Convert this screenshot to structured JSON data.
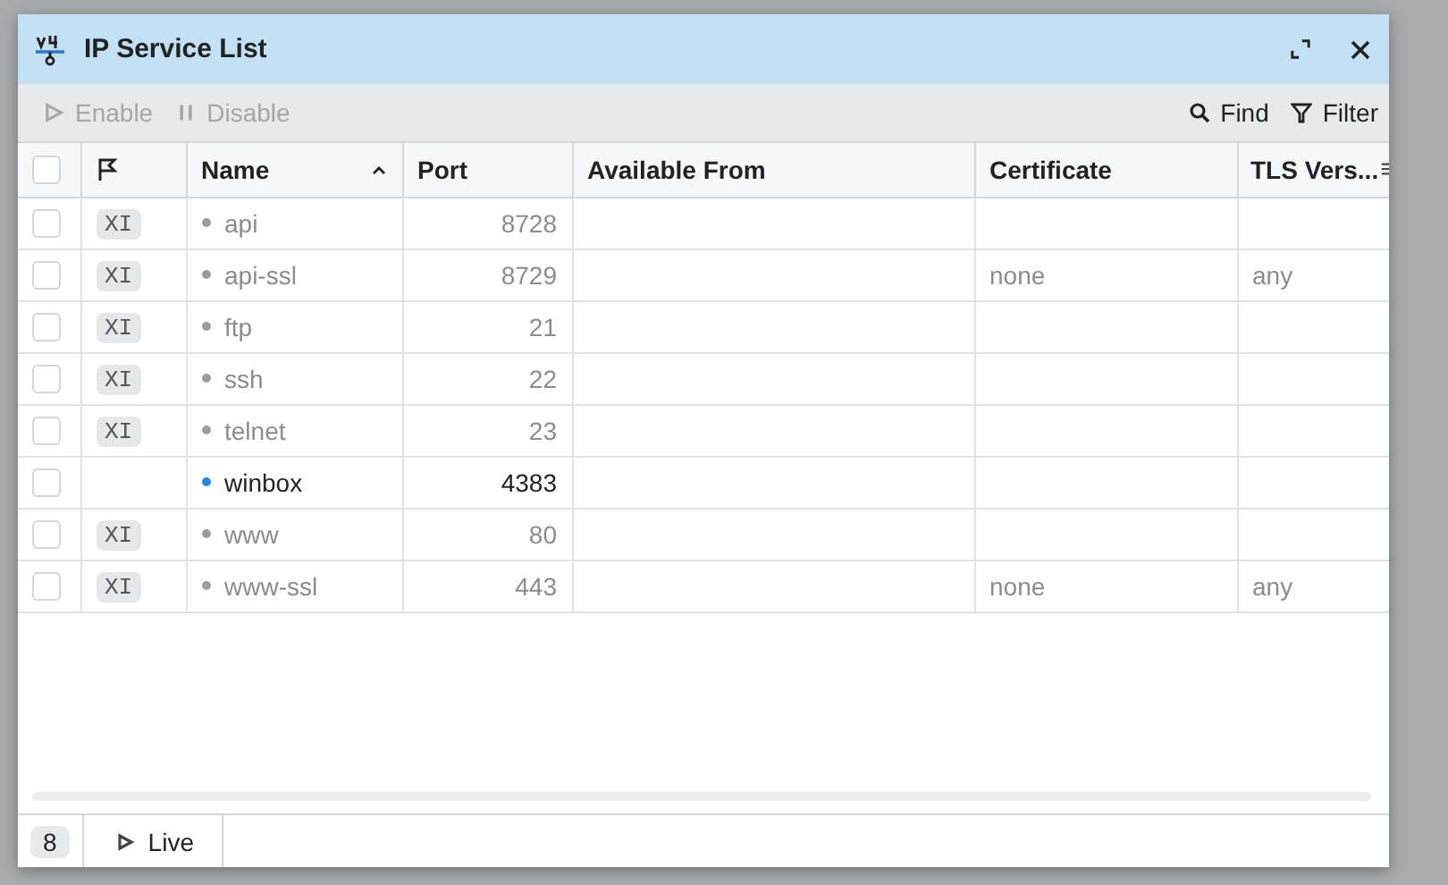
{
  "window": {
    "title": "IP Service List"
  },
  "toolbar": {
    "actions": [
      {
        "label": "Enable",
        "kind": "play",
        "disabled": true
      },
      {
        "label": "Disable",
        "kind": "pause",
        "disabled": true
      }
    ],
    "tools": [
      {
        "label": "Find",
        "kind": "search"
      },
      {
        "label": "Filter",
        "kind": "filter"
      }
    ]
  },
  "table": {
    "select_all_checked": false,
    "columns": [
      {
        "label": "Name",
        "sorted": true
      },
      {
        "label": "Port",
        "sorted": false
      },
      {
        "label": "Available From",
        "sorted": false
      },
      {
        "label": "Certificate",
        "sorted": false
      },
      {
        "label": "TLS Vers...",
        "sorted": false
      }
    ],
    "rows": [
      {
        "checked": false,
        "flag": "XI",
        "name": "api",
        "port": "8728",
        "available_from": "",
        "certificate": "",
        "tls_version": "",
        "disabled": true
      },
      {
        "checked": false,
        "flag": "XI",
        "name": "api-ssl",
        "port": "8729",
        "available_from": "",
        "certificate": "none",
        "tls_version": "any",
        "disabled": true
      },
      {
        "checked": false,
        "flag": "XI",
        "name": "ftp",
        "port": "21",
        "available_from": "",
        "certificate": "",
        "tls_version": "",
        "disabled": true
      },
      {
        "checked": false,
        "flag": "XI",
        "name": "ssh",
        "port": "22",
        "available_from": "",
        "certificate": "",
        "tls_version": "",
        "disabled": true
      },
      {
        "checked": false,
        "flag": "XI",
        "name": "telnet",
        "port": "23",
        "available_from": "",
        "certificate": "",
        "tls_version": "",
        "disabled": true
      },
      {
        "checked": false,
        "flag": "",
        "name": "winbox",
        "port": "4383",
        "available_from": "",
        "certificate": "",
        "tls_version": "",
        "disabled": false
      },
      {
        "checked": false,
        "flag": "XI",
        "name": "www",
        "port": "80",
        "available_from": "",
        "certificate": "",
        "tls_version": "",
        "disabled": true
      },
      {
        "checked": false,
        "flag": "XI",
        "name": "www-ssl",
        "port": "443",
        "available_from": "",
        "certificate": "none",
        "tls_version": "any",
        "disabled": true
      }
    ]
  },
  "status_bar": {
    "count": "8",
    "live": "Live"
  }
}
